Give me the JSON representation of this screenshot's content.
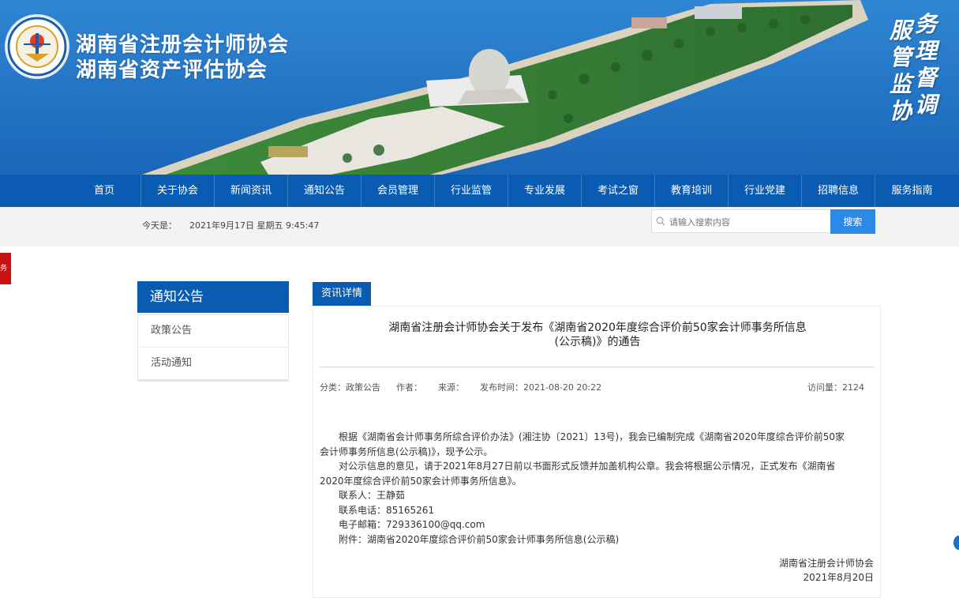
{
  "banner": {
    "org_name_1": "湖南省注册会计师协会",
    "org_name_2": "湖南省资产评估协会",
    "motto_col_1": [
      "服",
      "管",
      "监",
      "协"
    ],
    "motto_col_2": [
      "务",
      "理",
      "督",
      "调"
    ]
  },
  "nav": {
    "items": [
      "首页",
      "关于协会",
      "新闻资讯",
      "通知公告",
      "会员管理",
      "行业监管",
      "专业发展",
      "考试之窗",
      "教育培训",
      "行业党建",
      "招聘信息",
      "服务指南"
    ]
  },
  "infobar": {
    "today_label": "今天是：",
    "today_value": "2021年9月17日 星期五 9:45:47",
    "search_placeholder": "请输入搜索内容",
    "search_button": "搜索"
  },
  "side_tab_text": "务",
  "sidebar": {
    "title": "通知公告",
    "items": [
      "政策公告",
      "活动通知"
    ]
  },
  "article": {
    "tab_label": "资讯详情",
    "title_line_1": "湖南省注册会计师协会关于发布《湖南省2020年度综合评价前50家会计师事务所信息",
    "title_line_2": "(公示稿)》的通告",
    "meta": {
      "category": "分类：政策公告",
      "author": "作者：",
      "source": "来源：",
      "publish_time": "发布时间：2021-08-20 20:22",
      "views": "访问量：2124"
    },
    "paragraphs": [
      "根据《湖南省会计师事务所综合评价办法》(湘注协〔2021〕13号)，我会已编制完成《湖南省2020年度综合评价前50家",
      "会计师事务所信息(公示稿)》，现予公示。",
      "对公示信息的意见，请于2021年8月27日前以书面形式反馈并加盖机构公章。我会将根据公示情况，正式发布《湖南省",
      "2020年度综合评价前50家会计师事务所信息》。",
      "联系人：王静茹",
      "联系电话：85165261",
      "电子邮箱：729336100@qq.com",
      "附件：湖南省2020年度综合评价前50家会计师事务所信息(公示稿)"
    ],
    "signature_org": "湖南省注册会计师协会",
    "signature_date": "2021年8月20日"
  },
  "colors": {
    "nav_blue": "#0a5cb2",
    "search_blue": "#2b8ae6",
    "side_red": "#c91212"
  }
}
